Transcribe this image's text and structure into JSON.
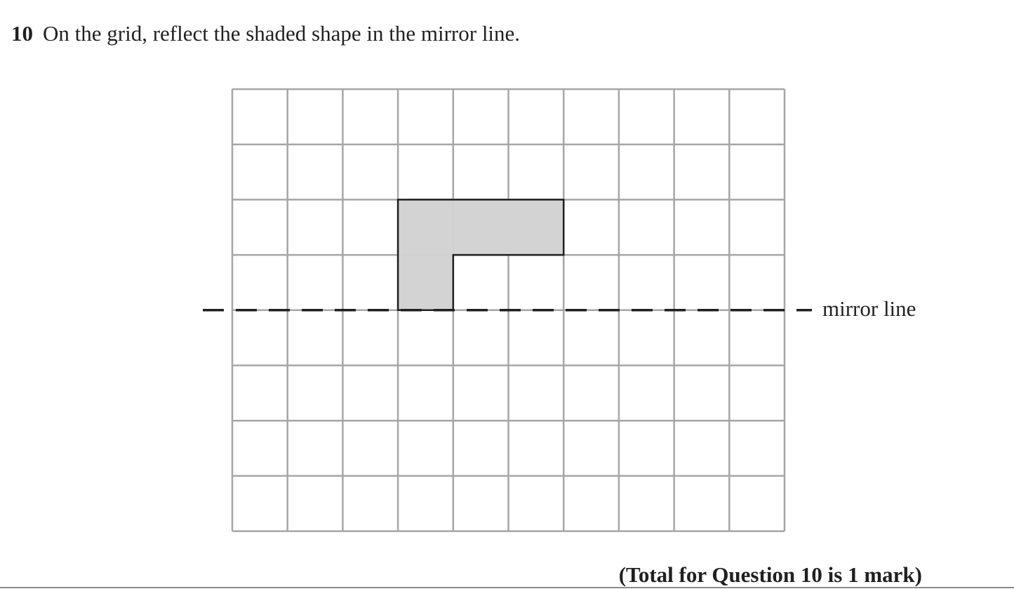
{
  "question": {
    "number": "10",
    "text": "On the grid, reflect the shaded shape in the mirror line."
  },
  "grid": {
    "columns": 10,
    "rows": 8,
    "line_color": "#a6a6a6",
    "mirror_after_row": 4,
    "shaded_shape": {
      "fill": "#d3d3d3",
      "outline": "#231f20",
      "cells": [
        [
          3,
          2
        ],
        [
          4,
          2
        ],
        [
          5,
          2
        ],
        [
          3,
          3
        ]
      ]
    }
  },
  "mirror": {
    "label": "mirror line",
    "style": "dashed"
  },
  "footer": {
    "total": "(Total for Question 10 is 1 mark)"
  }
}
